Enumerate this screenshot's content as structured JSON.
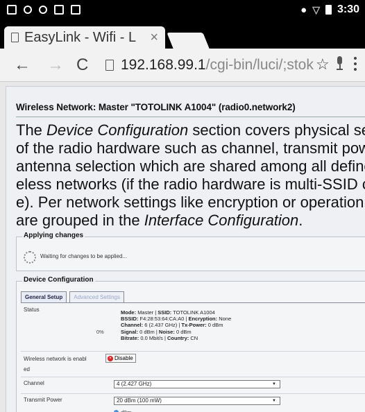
{
  "status_bar": {
    "time": "3:30",
    "icons": [
      "screenshot-icon",
      "notification-icon",
      "notification-icon",
      "phone-icon",
      "image-icon",
      "location-icon",
      "wifi-icon",
      "battery-icon"
    ]
  },
  "browser": {
    "tab_title": "EasyLink - Wifi - L",
    "tab_close": "×",
    "url_host": "192.168.99.1",
    "url_path": "/cgi-bin/luci/;stok"
  },
  "page": {
    "network_heading": "Wireless Network: Master \"TOTOLINK A1004\" (radio0.network2)",
    "description": {
      "line1_pre": "The ",
      "line1_em": "Device Configuration",
      "line1_post": " section covers physical setti",
      "line2": "of the radio hardware such as channel, transmit power",
      "line3": "antenna selection which are shared among all defined",
      "line4": "eless networks (if the radio hardware is multi-SSID cap",
      "line5": "e). Per network settings like encryption or operation m",
      "line6_pre": "are grouped in the ",
      "line6_em": "Interface Configuration",
      "line6_post": "."
    },
    "applying": {
      "legend": "Applying changes",
      "message": "Waiting for changes to be applied..."
    },
    "device_config": {
      "legend": "Device Configuration",
      "tabs": [
        {
          "label": "General Setup",
          "active": true
        },
        {
          "label": "Advanced Settings",
          "active": false
        }
      ],
      "status_label": "Status",
      "signal_percent": "0%",
      "status": {
        "mode_label": "Mode:",
        "mode": "Master",
        "ssid_label": "SSID:",
        "ssid": "TOTOLINK A1004",
        "bssid_label": "BSSID:",
        "bssid": "F4:28:53:64:CA:A0",
        "enc_label": "Encryption:",
        "enc": "None",
        "channel_label": "Channel:",
        "channel": "6 (2.437 GHz)",
        "txpower_label": "Tx-Power:",
        "txpower": "0 dBm",
        "signal_label": "Signal:",
        "signal": "0 dBm",
        "noise_label": "Noise:",
        "noise": "0 dBm",
        "bitrate_label": "Bitrate:",
        "bitrate": "0.0 Mbit/s",
        "country_label": "Country:",
        "country": "CN"
      },
      "wireless_enabled_label_1": "Wireless network is enabl",
      "wireless_enabled_label_2": "ed",
      "disable_button": "Disable",
      "channel_label": "Channel",
      "channel_value": "4 (2.427 GHz)",
      "transmit_label": "Transmit Power",
      "transmit_value": "20 dBm (100 mW)",
      "unit": "dBm"
    }
  },
  "colors": {
    "accent_blue": "#4a8fd8",
    "disable_red": "#dd2222",
    "page_bg": "#eef0f4"
  }
}
